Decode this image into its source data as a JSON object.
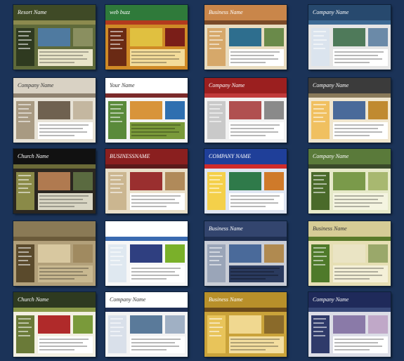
{
  "page": {
    "background": "#1b3358"
  },
  "thumbnails": [
    {
      "title": "Resort Name",
      "bg": "#5f6a3a",
      "head": "#3f4a26",
      "nav": "#8c8a4e",
      "side": "#2f3a20",
      "pic": "#4f7aa0",
      "pic2": "#8a8f60",
      "body": "#e8e4c8",
      "dark": false
    },
    {
      "title": "web buzz",
      "bg": "#cf8a26",
      "head": "#2f7a3a",
      "nav": "#b23a1e",
      "side": "#6a2a14",
      "pic": "#e0c040",
      "pic2": "#7a1e18",
      "body": "#f3dc9a",
      "dark": false
    },
    {
      "title": "Business Name",
      "bg": "#e9dcc0",
      "head": "#c9864a",
      "nav": "#7a4a28",
      "side": "#d6a86a",
      "pic": "#2e6e8e",
      "pic2": "#6a8a4a",
      "body": "#ffffff",
      "dark": false
    },
    {
      "title": "Company Name",
      "bg": "#e6e6e6",
      "head": "#27496e",
      "nav": "#3d6a94",
      "side": "#dbe4ee",
      "pic": "#4f7a5a",
      "pic2": "#6b8aa8",
      "body": "#ffffff",
      "dark": false
    },
    {
      "title": "Company Name",
      "bg": "#e7e2d6",
      "head": "#d9d2c4",
      "nav": "#8f8270",
      "side": "#a89a82",
      "pic": "#6f6150",
      "pic2": "#c4b7a0",
      "body": "#ffffff",
      "dark": true
    },
    {
      "title": "Your Name",
      "bg": "#f4f4f4",
      "head": "#ffffff",
      "nav": "#7b2a2a",
      "side": "#5a8a3a",
      "pic": "#d8943a",
      "pic2": "#2f6fb0",
      "body": "#7a9a3a",
      "dark": true
    },
    {
      "title": "Company Name",
      "bg": "#f2f2f2",
      "head": "#9b1f1f",
      "nav": "#c03a3a",
      "side": "#c9c9c9",
      "pic": "#b05050",
      "pic2": "#8a8a8a",
      "body": "#ffffff",
      "dark": false
    },
    {
      "title": "Company Name",
      "bg": "#f0e6cf",
      "head": "#3b3b3b",
      "nav": "#8a7a5a",
      "side": "#f0c060",
      "pic": "#4a6a9a",
      "pic2": "#c08a30",
      "body": "#ffffff",
      "dark": false
    },
    {
      "title": "Church Name",
      "bg": "#2b2720",
      "head": "#111111",
      "nav": "#6b6a38",
      "side": "#8a8a48",
      "pic": "#b07a50",
      "pic2": "#5a6a40",
      "body": "#d9d6c4",
      "dark": false
    },
    {
      "title": "BUSINESSNAME",
      "bg": "#e9dfc9",
      "head": "#8a1f1f",
      "nav": "#5a1a1a",
      "side": "#cbb690",
      "pic": "#9a2f2f",
      "pic2": "#b08a5a",
      "body": "#ffffff",
      "dark": false
    },
    {
      "title": "COMPANY NAME",
      "bg": "#dfe6f2",
      "head": "#1f3f99",
      "nav": "#cf2b2b",
      "side": "#f4d04a",
      "pic": "#2f7a4a",
      "pic2": "#cf7a2a",
      "body": "#ffffff",
      "dark": false
    },
    {
      "title": "Company Name",
      "bg": "#e6e9c9",
      "head": "#5a7a3a",
      "nav": "#3a4a2a",
      "side": "#4a6a2a",
      "pic": "#7a9a4a",
      "pic2": "#a8b870",
      "body": "#f4f4e0",
      "dark": false
    },
    {
      "title": "",
      "bg": "#b2a07a",
      "head": "#8a7a56",
      "nav": "#6a5a3a",
      "side": "#5a4a2c",
      "pic": "#d8c8a0",
      "pic2": "#a08a60",
      "body": "#c8b890",
      "dark": false
    },
    {
      "title": "",
      "bg": "#f7f7f7",
      "head": "#ffffff",
      "nav": "#3a6ab0",
      "side": "#dfe8f0",
      "pic": "#2f3f80",
      "pic2": "#7ab02a",
      "body": "#ffffff",
      "dark": true
    },
    {
      "title": "Business Name",
      "bg": "#c9cdd6",
      "head": "#33456e",
      "nav": "#1f2f50",
      "side": "#9aa5b8",
      "pic": "#4a6a9a",
      "pic2": "#b08a50",
      "body": "#2a3a5e",
      "dark": false
    },
    {
      "title": "Business Name",
      "bg": "#e6dfb4",
      "head": "#d6cc96",
      "nav": "#5a7a2a",
      "side": "#4f7a2a",
      "pic": "#eae4c4",
      "pic2": "#9aa86a",
      "body": "#f4f0d8",
      "dark": true
    },
    {
      "title": "Church Name",
      "bg": "#f3f0e2",
      "head": "#2e3a20",
      "nav": "#8a9a4a",
      "side": "#6a7a38",
      "pic": "#b02a2a",
      "pic2": "#7a9a3a",
      "body": "#ffffff",
      "dark": false
    },
    {
      "title": "Company Name",
      "bg": "#f4f4f4",
      "head": "#ffffff",
      "nav": "#1f2f55",
      "side": "#d9e0ea",
      "pic": "#5a7a9a",
      "pic2": "#a0b0c4",
      "body": "#ffffff",
      "dark": true
    },
    {
      "title": "Business Name",
      "bg": "#caa33a",
      "head": "#b8902a",
      "nav": "#6a4a1a",
      "side": "#e8c45a",
      "pic": "#f0d890",
      "pic2": "#8a6a2a",
      "body": "#f3dea0",
      "dark": false
    },
    {
      "title": "Company Name",
      "bg": "#dcdde6",
      "head": "#1f2a5a",
      "nav": "#3a4a7a",
      "side": "#2f3a6a",
      "pic": "#8a7aa8",
      "pic2": "#c0a8c8",
      "body": "#ffffff",
      "dark": false
    }
  ]
}
